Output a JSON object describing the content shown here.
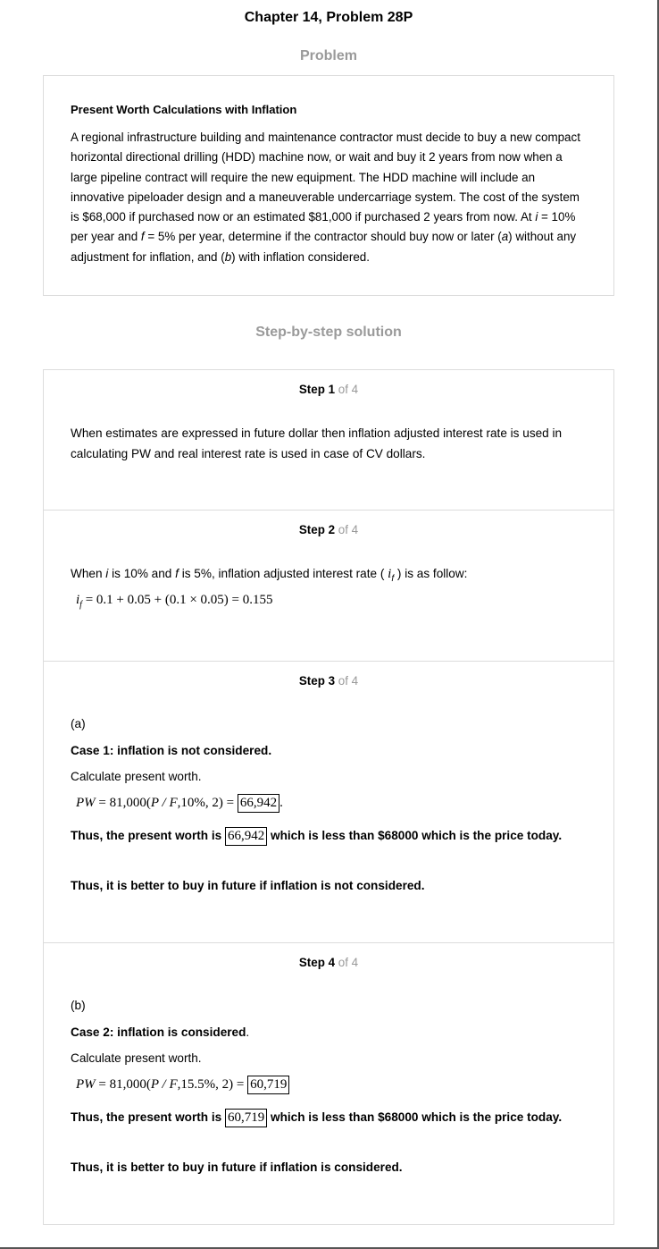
{
  "header": {
    "chapter_title": "Chapter 14, Problem 28P"
  },
  "problem": {
    "heading": "Problem",
    "title": "Present Worth Calculations with Inflation",
    "text_1": "A regional infrastructure building and maintenance contractor must decide to buy a new compact horizontal directional drilling (HDD) machine now, or wait and buy it 2 years from now when a large pipeline contract will require the new equipment. The HDD machine will include an innovative pipeloader design and a maneuverable undercarriage system. The cost of the system is $68,000 if purchased now or an estimated $81,000 if purchased 2 years from now. At ",
    "i_var": "i",
    "text_2": " = 10% per year and ",
    "f_var": "f",
    "text_3": " = 5% per year, determine if the contractor should buy now or later (",
    "a_var": "a",
    "text_4": ") without any adjustment for inflation, and (",
    "b_var": "b",
    "text_5": ") with inflation considered."
  },
  "solution": {
    "heading": "Step-by-step solution",
    "of_label": "of 4",
    "step1": {
      "label": "Step 1",
      "text": "When estimates are expressed in future dollar then inflation adjusted interest rate is used in calculating PW and real interest rate is used in case of CV dollars."
    },
    "step2": {
      "label": "Step 2",
      "text_a": "When ",
      "i_var": "i",
      "text_b": " is 10% and ",
      "f_var": "f",
      "text_c": " is 5%, inflation adjusted interest rate ( ",
      "sym_i": "i",
      "sym_f": "f",
      "text_d": " ) is as follow:",
      "eq_lhs_i": "i",
      "eq_lhs_f": "f",
      "eq_rhs": " = 0.1 + 0.05 + (0.1 × 0.05) = 0.155"
    },
    "step3": {
      "label": "Step 3",
      "part": "(a)",
      "case": "Case 1: inflation is not considered.",
      "calc": "Calculate present worth.",
      "eq_pw": "PW",
      "eq_mid": " = 81,000(",
      "eq_pf": "P / F",
      "eq_rest": ",10%, 2) = ",
      "eq_result": "66,942",
      "eq_end": ".",
      "thus_pre": "Thus, the present worth is ",
      "thus_value": "66,942",
      "thus_post": " which is less than $68000 which is the price today.",
      "conclusion": "Thus, it is better to buy in future if inflation is not considered."
    },
    "step4": {
      "label": "Step 4",
      "part": "(b)",
      "case": "Case 2: inflation is considered",
      "case_end": ".",
      "calc": "Calculate present worth.",
      "eq_pw": "PW",
      "eq_mid": " = 81,000(",
      "eq_pf": "P / F",
      "eq_rest": ",15.5%, 2) = ",
      "eq_result": "60,719",
      "thus_pre": "Thus, the present worth is ",
      "thus_value": "60,719",
      "thus_post": " which is less than $68000 which is the price today.",
      "conclusion": "Thus, it is better to buy in future if inflation is considered."
    }
  }
}
